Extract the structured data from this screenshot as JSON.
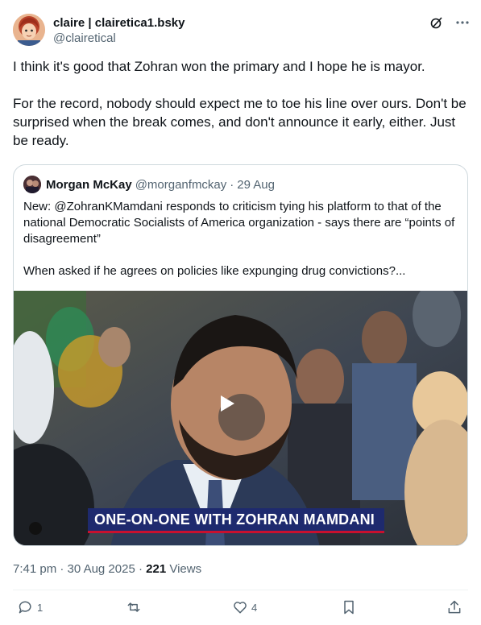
{
  "author": {
    "display_name": "claire | clairetica1.bsky",
    "handle": "@clairetical"
  },
  "tweet": {
    "paragraphs": [
      "I think it's good that Zohran won the primary and I hope he is mayor.",
      "For the record, nobody should expect me to toe his line over ours. Don't be surprised when the break comes, and don't announce it early, either. Just be ready."
    ]
  },
  "quote": {
    "display_name": "Morgan McKay",
    "handle": "@morganfmckay",
    "separator": "·",
    "date": "29 Aug",
    "paragraphs": [
      "New: @ZohranKMamdani responds to criticism tying his platform to that of the national Democratic Socialists of America organization - says there are “points of disagreement”",
      "When asked if he agrees on policies like expunging drug convictions?..."
    ],
    "video": {
      "chyron": "ONE-ON-ONE WITH ZOHRAN MAMDANI",
      "play_icon": "play-icon"
    }
  },
  "meta": {
    "time": "7:41 pm",
    "sep1": "·",
    "date": "30 Aug 2025",
    "sep2": "·",
    "views_count": "221",
    "views_label": "Views"
  },
  "actions": {
    "reply_count": "1",
    "repost_count": "",
    "like_count": "4"
  },
  "colors": {
    "text": "#0f1419",
    "secondary": "#536471",
    "border": "#cfd9de",
    "chyron_bg": "#1e2a6e",
    "chyron_accent": "#c8102e"
  }
}
